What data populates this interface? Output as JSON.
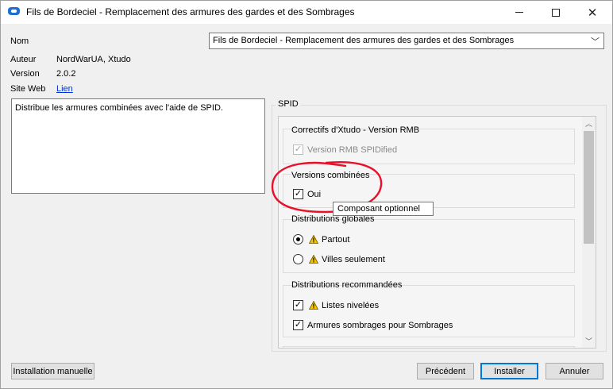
{
  "window": {
    "title": "Fils de Bordeciel - Remplacement des armures des gardes et des Sombrages"
  },
  "info": {
    "name_label": "Nom",
    "name_value": "Fils de Bordeciel - Remplacement des armures des gardes et des Sombrages",
    "author_label": "Auteur",
    "author_value": "NordWarUA, Xtudo",
    "version_label": "Version",
    "version_value": "2.0.2",
    "website_label": "Site Web",
    "website_link": "Lien"
  },
  "description": "Distribue les armures combinées avec l'aide de SPID.",
  "spid": {
    "legend": "SPID",
    "groups": [
      {
        "title": "Correctifs d'Xtudo - Version RMB",
        "options": [
          {
            "label": "Version RMB SPIDified",
            "type": "checkbox",
            "checked": true,
            "disabled": true
          }
        ]
      },
      {
        "title": "Versions combinées",
        "options": [
          {
            "label": "Oui",
            "type": "checkbox",
            "checked": true
          }
        ]
      },
      {
        "title": "Distributions globales",
        "options": [
          {
            "label": "Partout",
            "type": "radio",
            "selected": true,
            "icon": "warning-icon"
          },
          {
            "label": "Villes seulement",
            "type": "radio",
            "selected": false,
            "icon": "warning-icon"
          }
        ]
      },
      {
        "title": "Distributions recommandées",
        "options": [
          {
            "label": "Listes nivelées",
            "type": "checkbox",
            "checked": true,
            "icon": "warning-icon"
          },
          {
            "label": "Armures sombrages pour Sombrages",
            "type": "checkbox",
            "checked": true
          }
        ]
      }
    ]
  },
  "tooltip": "Composant optionnel",
  "buttons": {
    "manual_install": "Installation manuelle",
    "previous": "Précédent",
    "install": "Installer",
    "cancel": "Annuler"
  },
  "colors": {
    "accent": "#0078d7",
    "annotation_red": "#e8102a",
    "warning_yellow": "#f5c400"
  }
}
